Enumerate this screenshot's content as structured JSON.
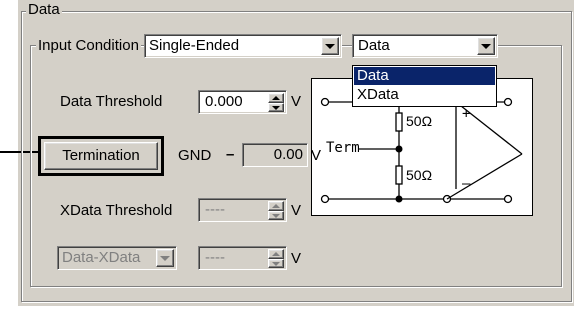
{
  "group": {
    "title": "Data"
  },
  "input_condition": {
    "label": "Input Condition",
    "mode_value": "Single-Ended",
    "signal_value": "Data",
    "dropdown_options": [
      "Data",
      "XData"
    ],
    "selected_option": "Data"
  },
  "data_threshold": {
    "label": "Data Threshold",
    "value": "0.000",
    "unit": "V"
  },
  "termination": {
    "button_label": "Termination",
    "gnd_label": "GND",
    "dash": "–",
    "value": "0.00",
    "unit": "V"
  },
  "xdata_threshold": {
    "label": "XData Threshold",
    "value": "----",
    "unit": "V"
  },
  "data_xdata": {
    "select_value": "Data-XData",
    "value": "----",
    "unit": "V"
  },
  "diagram": {
    "term_label": "Term",
    "resistor_top": "50Ω",
    "resistor_bottom": "50Ω",
    "plus": "+",
    "minus": "–"
  },
  "colors": {
    "face": "#d4d0c8",
    "highlight": "#0a246a",
    "highlight_text": "#ffffff"
  }
}
